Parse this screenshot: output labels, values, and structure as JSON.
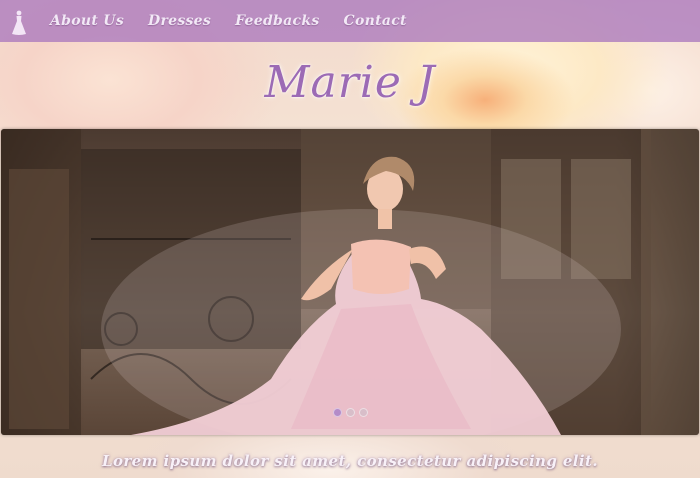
{
  "nav": {
    "logo": "dress-icon",
    "items": [
      {
        "label": "About Us"
      },
      {
        "label": "Dresses"
      },
      {
        "label": "Feedbacks"
      },
      {
        "label": "Contact"
      }
    ]
  },
  "brand": {
    "title": "Marie J"
  },
  "slider": {
    "image": "woman-in-pink-ballgown-photo",
    "dots": 3,
    "active_dot": 1
  },
  "footer": {
    "text": "Lorem ipsum dolor sit amet, consectetur adipiscing elit."
  },
  "colors": {
    "nav_bar": "#aa78be",
    "title": "#9c6bb5",
    "nav_text": "#f2e8f6"
  }
}
